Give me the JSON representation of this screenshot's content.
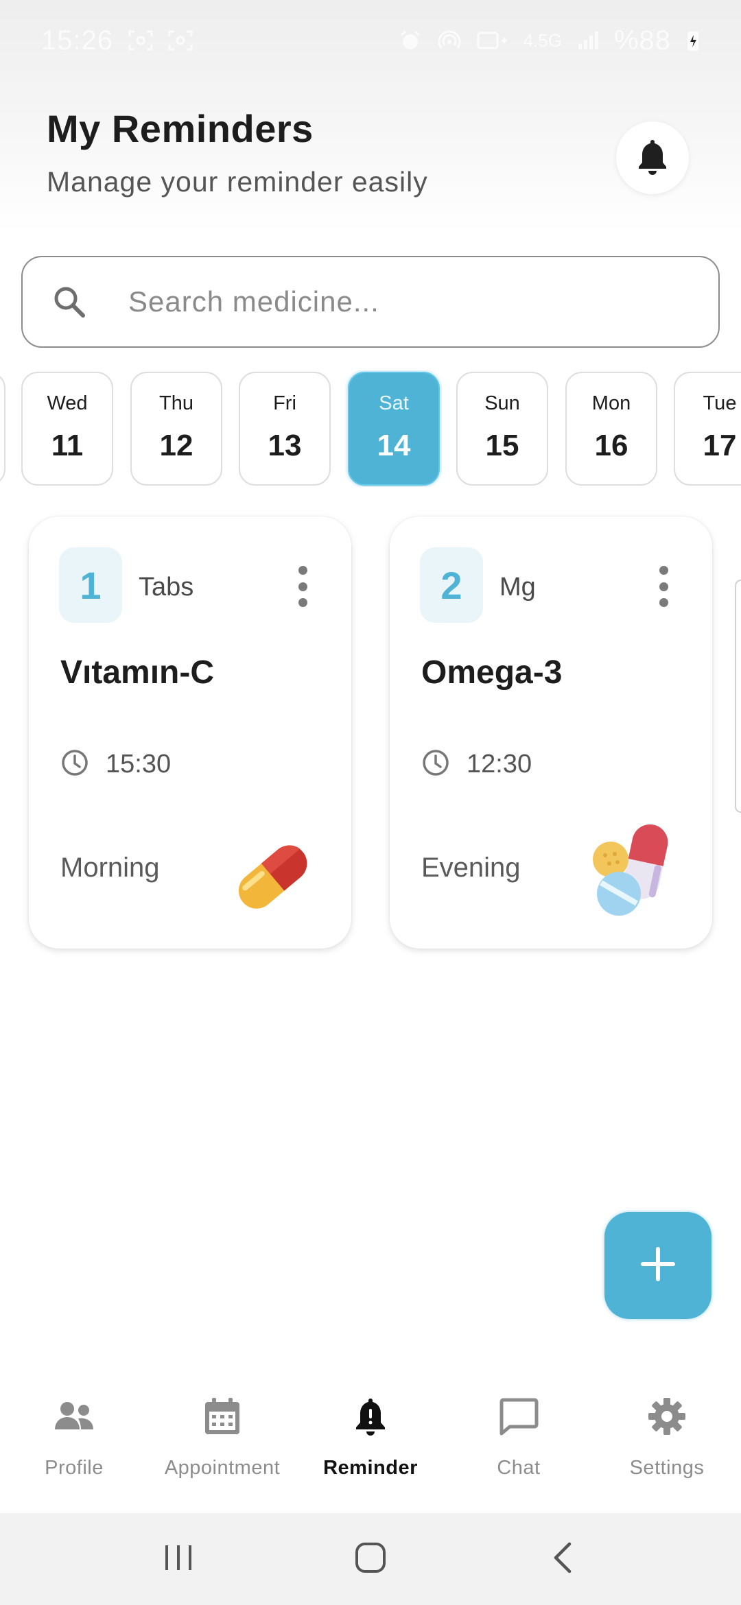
{
  "status_bar": {
    "time": "15:26",
    "network": "4.5G",
    "battery": "%88"
  },
  "header": {
    "title": "My Reminders",
    "subtitle": "Manage your reminder easily"
  },
  "search": {
    "placeholder": "Search medicine..."
  },
  "dates": [
    {
      "dow": "Wed",
      "dom": "11",
      "selected": false
    },
    {
      "dow": "Thu",
      "dom": "12",
      "selected": false
    },
    {
      "dow": "Fri",
      "dom": "13",
      "selected": false
    },
    {
      "dow": "Sat",
      "dom": "14",
      "selected": true
    },
    {
      "dow": "Sun",
      "dom": "15",
      "selected": false
    },
    {
      "dow": "Mon",
      "dom": "16",
      "selected": false
    },
    {
      "dow": "Tue",
      "dom": "17",
      "selected": false
    }
  ],
  "medicines": [
    {
      "quantity": "1",
      "unit": "Tabs",
      "name": "Vıtamın-C",
      "time": "15:30",
      "period": "Morning",
      "illustration": "capsule-icon"
    },
    {
      "quantity": "2",
      "unit": "Mg",
      "name": "Omega-3",
      "time": "12:30",
      "period": "Evening",
      "illustration": "pills-icon"
    }
  ],
  "fab": {
    "icon": "plus-icon"
  },
  "bottom_nav": {
    "items": [
      {
        "label": "Profile",
        "icon": "people-icon",
        "active": false
      },
      {
        "label": "Appointment",
        "icon": "calendar-icon",
        "active": false
      },
      {
        "label": "Reminder",
        "icon": "bell-alert-icon",
        "active": true
      },
      {
        "label": "Chat",
        "icon": "chat-icon",
        "active": false
      },
      {
        "label": "Settings",
        "icon": "gear-icon",
        "active": false
      }
    ]
  },
  "colors": {
    "accent": "#4fb3d6",
    "accent_light": "#e9f5f9",
    "text_dark": "#1d1d1d",
    "text_muted": "#8c8c8c"
  }
}
